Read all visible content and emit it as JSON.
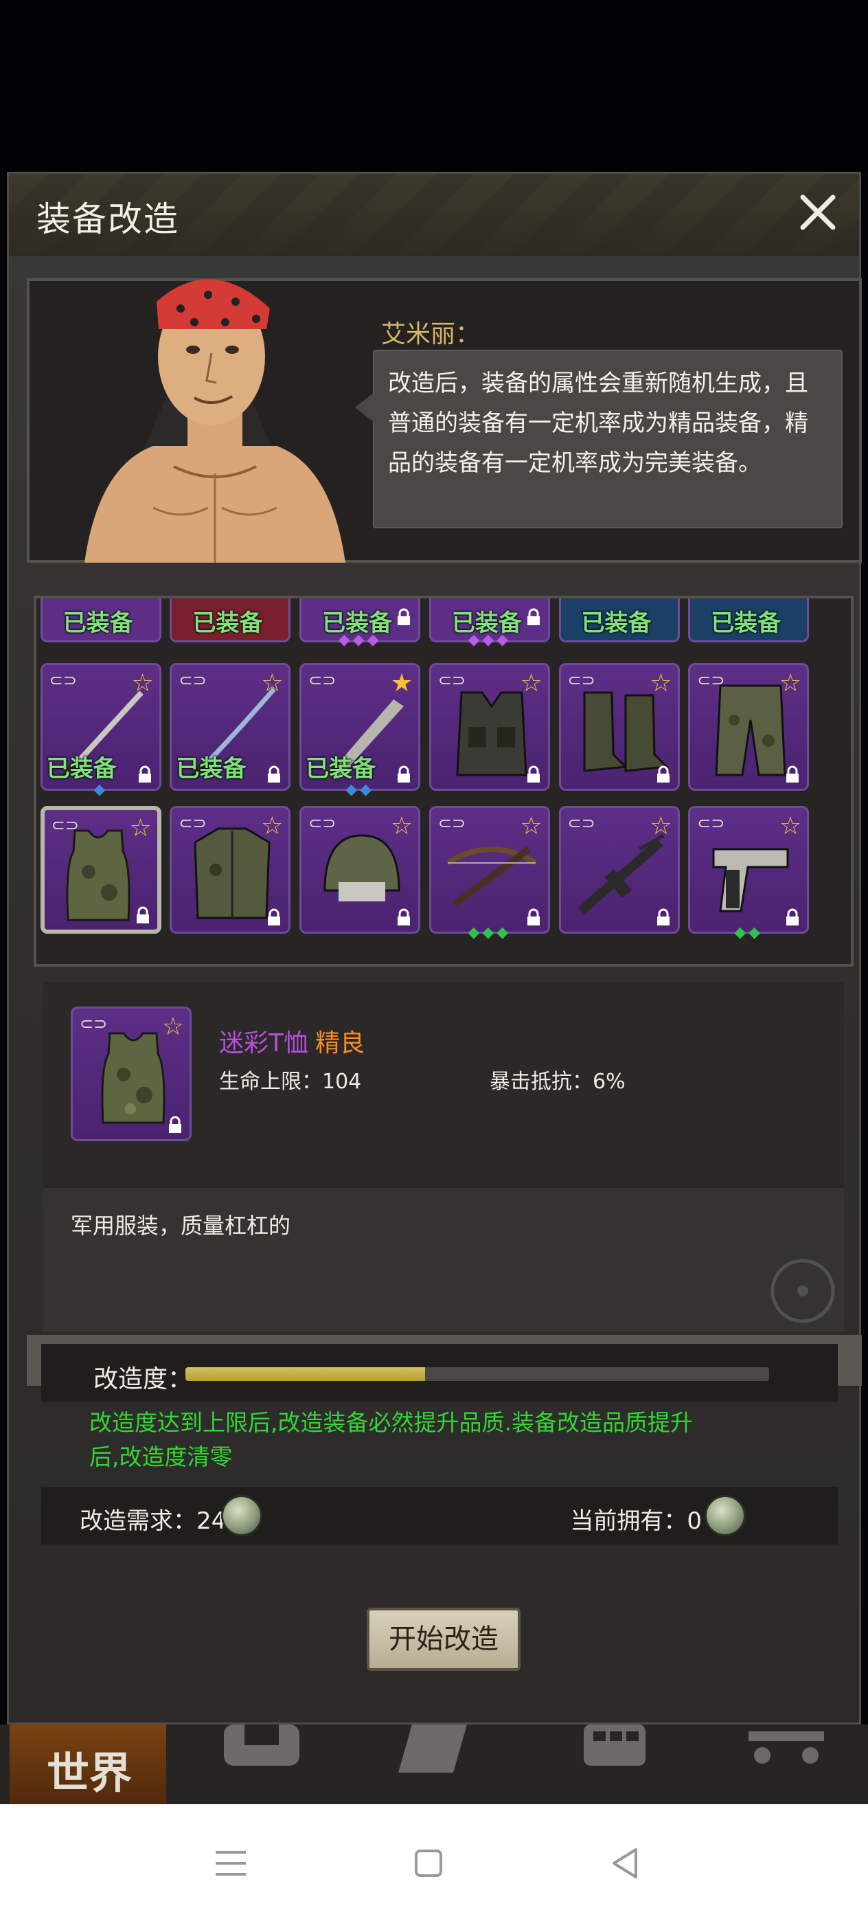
{
  "window": {
    "title": "装备改造"
  },
  "npc": {
    "name": "艾米丽：",
    "speech_lines": [
      "改造后，装备的属性会重新随机生成，且",
      "普通的装备有一定机率成为精品装备，精",
      "品的装备有一定机率成为完美装备。"
    ]
  },
  "grid": {
    "equipped_label": "已装备",
    "top_row": [
      {
        "color": "#5d2e86",
        "gems": "",
        "gem_color": "#3b8ad8",
        "locked": false
      },
      {
        "color": "#7a1f2e",
        "gems": "",
        "gem_color": "#3b8ad8",
        "locked": false
      },
      {
        "color": "#5d2e86",
        "gems": "◆◆◆",
        "gem_color": "#b55ce8",
        "locked": true
      },
      {
        "color": "#5d2e86",
        "gems": "◆◆◆",
        "gem_color": "#b55ce8",
        "locked": true
      },
      {
        "color": "#1c3f66",
        "gems": "",
        "gem_color": "#3b8ad8",
        "locked": false
      },
      {
        "color": "#1c3f66",
        "gems": "",
        "gem_color": "#3b8ad8",
        "locked": false
      }
    ],
    "row2": [
      {
        "item": "sword",
        "equipped": true,
        "gems": "◆",
        "gem_color": "#3b8ad8",
        "star": "gold-outline"
      },
      {
        "item": "katana",
        "equipped": true,
        "gems": "",
        "gem_color": "#3b8ad8",
        "star": "gold-outline"
      },
      {
        "item": "machete",
        "equipped": true,
        "gems": "◆◆",
        "gem_color": "#3b8ad8",
        "star": "gold-filled"
      },
      {
        "item": "vest",
        "equipped": false,
        "gems": "",
        "gem_color": "#3b8ad8",
        "star": "gold-outline"
      },
      {
        "item": "boots",
        "equipped": false,
        "gems": "",
        "gem_color": "#3b8ad8",
        "star": "gold-outline"
      },
      {
        "item": "pants",
        "equipped": false,
        "gems": "",
        "gem_color": "#3b8ad8",
        "star": "gold-outline"
      }
    ],
    "row3": [
      {
        "item": "tank-top",
        "selected": true,
        "gems": "",
        "gem_color": "#2fc24d",
        "star": "gold-outline"
      },
      {
        "item": "jacket",
        "selected": false,
        "gems": "",
        "gem_color": "#2fc24d",
        "star": "gold-outline"
      },
      {
        "item": "helmet",
        "selected": false,
        "gems": "",
        "gem_color": "#2fc24d",
        "star": "gold-outline"
      },
      {
        "item": "crossbow",
        "selected": false,
        "gems": "◆◆◆",
        "gem_color": "#2fc24d",
        "star": "gold-outline"
      },
      {
        "item": "rifle",
        "selected": false,
        "gems": "",
        "gem_color": "#2fc24d",
        "star": "gold-outline"
      },
      {
        "item": "pistol",
        "selected": false,
        "gems": "◆◆",
        "gem_color": "#2fc24d",
        "star": "gold-outline"
      }
    ]
  },
  "detail": {
    "name": "迷彩T恤",
    "quality": "精良",
    "stat1": "生命上限：104",
    "stat2": "暴击抵抗：6%",
    "description": "军用服装，质量杠杠的"
  },
  "modify": {
    "label": "改造度：",
    "progress": 0.41,
    "note": "改造度达到上限后,改造装备必然提升品质.装备改造品质提升后,改造度清零",
    "requirement": "改造需求：24",
    "owned": "当前拥有：0",
    "start_button": "开始改造"
  },
  "nav": {
    "world": "世界"
  },
  "colors": {
    "equipped": "#7fe37a",
    "note": "#33d633",
    "quality": "#ff8a1e",
    "item_name": "#b74ddf"
  }
}
